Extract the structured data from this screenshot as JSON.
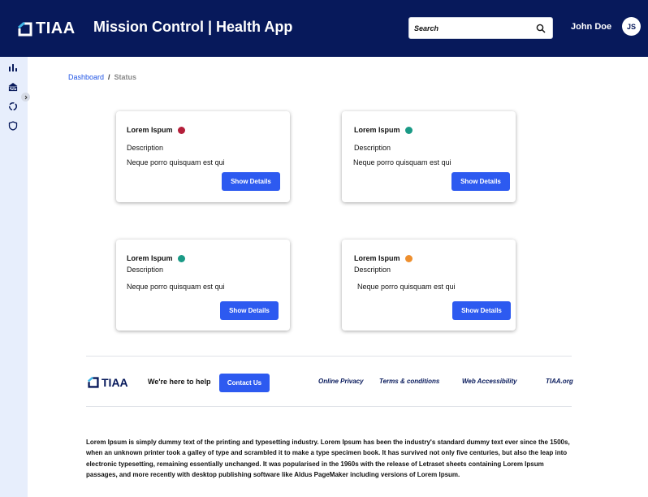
{
  "header": {
    "logo_text": "TIAA",
    "title": "Mission Control | Health App",
    "search_placeholder": "Search",
    "user_name": "John Doe",
    "user_initials": "JS"
  },
  "sidebar": {
    "icons": [
      "bar-chart-icon",
      "bank-icon",
      "circle-progress-icon",
      "shield-icon"
    ]
  },
  "breadcrumb": {
    "items": [
      "Dashboard",
      "Status"
    ],
    "separator": "/"
  },
  "cards": [
    {
      "title": "Lorem Ispum",
      "status_color": "#b41f3a",
      "description": "Description",
      "body": "Neque porro quisquam est qui",
      "button": "Show Details"
    },
    {
      "title": "Lorem Ispum",
      "status_color": "#1a9a86",
      "description": "Description",
      "body": "Neque porro quisquam est qui",
      "button": "Show Details"
    },
    {
      "title": "Lorem Ispum",
      "status_color": "#1a9a86",
      "description": "Description",
      "body": "Neque porro quisquam est qui",
      "button": "Show Details"
    },
    {
      "title": "Lorem Ispum",
      "status_color": "#ee8f2e",
      "description": "Description",
      "body": "Neque porro quisquam est qui",
      "button": "Show Details"
    }
  ],
  "footer": {
    "logo_text": "TIAA",
    "help_text": "We're here to help",
    "contact_button": "Contact Us",
    "links": [
      "Online Privacy",
      "Terms & conditions",
      "Web Accessibility",
      "TIAA.org"
    ],
    "paragraph": "Lorem Ipsum is simply dummy text of the printing and typesetting industry. Lorem Ipsum has been the industry's standard dummy text ever since the 1500s, when an unknown printer took a galley of type and scrambled it to make a type specimen book. It has survived not only five centuries, but also the leap into electronic typesetting, remaining essentially unchanged. It was popularised in the 1960s with the release of Letraset sheets containing Lorem Ipsum passages, and more recently with desktop publishing software like Aldus PageMaker including versions of Lorem Ipsum."
  },
  "colors": {
    "header_bg": "#07195b",
    "accent": "#2d5af0",
    "sidebar_bg": "#e7eefc"
  }
}
